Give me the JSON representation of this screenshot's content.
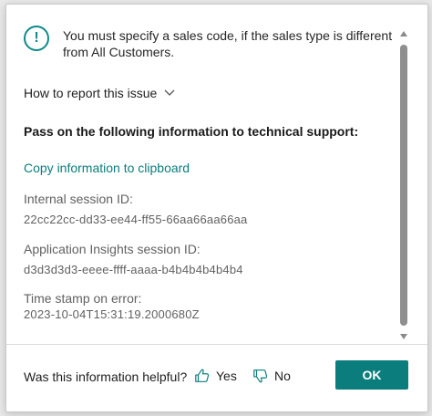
{
  "message": "You must specify a sales code, if the sales type is different from All Customers.",
  "report_toggle_label": "How to report this issue",
  "pass_on_heading": "Pass on the following information to technical support:",
  "copy_link_label": "Copy information to clipboard",
  "fields": [
    {
      "label": "Internal session ID:",
      "value": "22cc22cc-dd33-ee44-ff55-66aa66aa66aa"
    },
    {
      "label": "Application Insights session ID:",
      "value": "d3d3d3d3-eeee-ffff-aaaa-b4b4b4b4b4b4"
    },
    {
      "label": "Time stamp on error:",
      "value": "2023-10-04T15:31:19.2000680Z"
    }
  ],
  "footer": {
    "question": "Was this information helpful?",
    "yes_label": "Yes",
    "no_label": "No",
    "ok_label": "OK"
  },
  "colors": {
    "accent": "#0b7d7d",
    "icon_accent": "#0f8a8a",
    "muted_text": "#616161"
  },
  "icons": {
    "alert": "exclamation-circle-icon",
    "toggle": "chevron-down-icon",
    "yes": "thumbs-up-icon",
    "no": "thumbs-down-icon"
  }
}
